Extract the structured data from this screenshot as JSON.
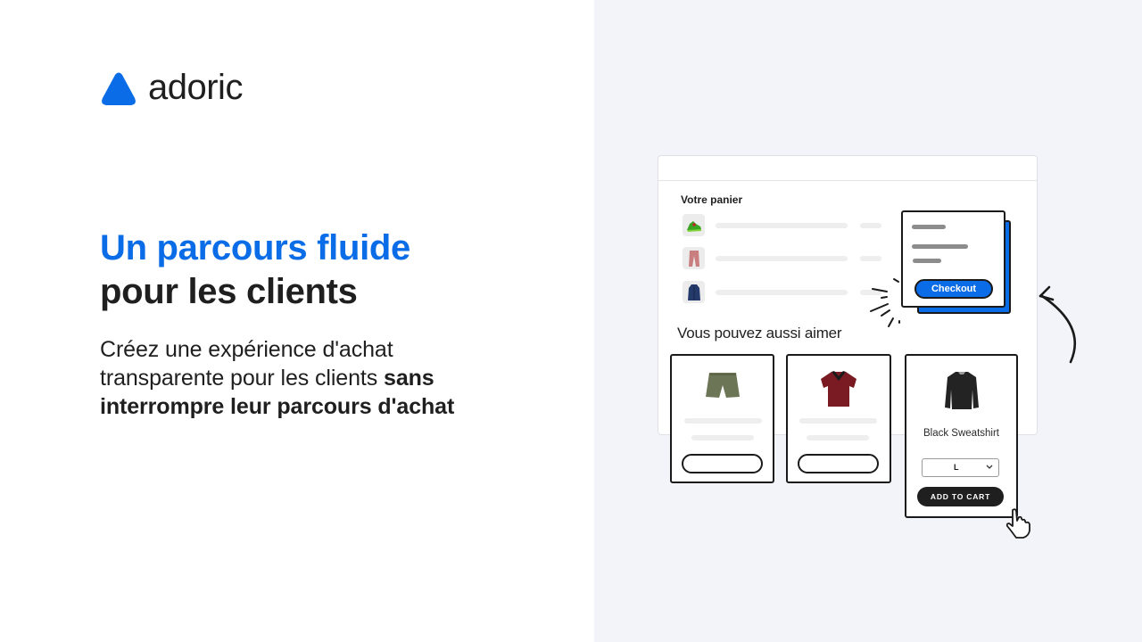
{
  "brand": {
    "name": "adoric",
    "logo_icon": "adoric-triangle-logo",
    "accent_color": "#0a6ce6",
    "text_color": "#1f1f1f"
  },
  "hero": {
    "headline_line1": "Un parcours fluide",
    "headline_line2": "pour les clients",
    "subtext_regular": "Créez une expérience d'achat transparente pour les clients ",
    "subtext_bold": "sans interrompre leur parcours d'achat"
  },
  "mockup": {
    "cart": {
      "title": "Votre panier",
      "items": [
        {
          "icon": "sneaker-icon"
        },
        {
          "icon": "pants-icon"
        },
        {
          "icon": "jacket-icon"
        }
      ]
    },
    "checkout_popup": {
      "button_label": "Checkout"
    },
    "recommendations": {
      "title": "Vous pouvez aussi aimer",
      "products": [
        {
          "icon": "shorts-icon"
        },
        {
          "icon": "shirt-icon"
        },
        {
          "icon": "sweatshirt-icon",
          "name": "Black Sweatshirt",
          "size_selected": "L",
          "cta": "ADD TO CART"
        }
      ]
    }
  }
}
